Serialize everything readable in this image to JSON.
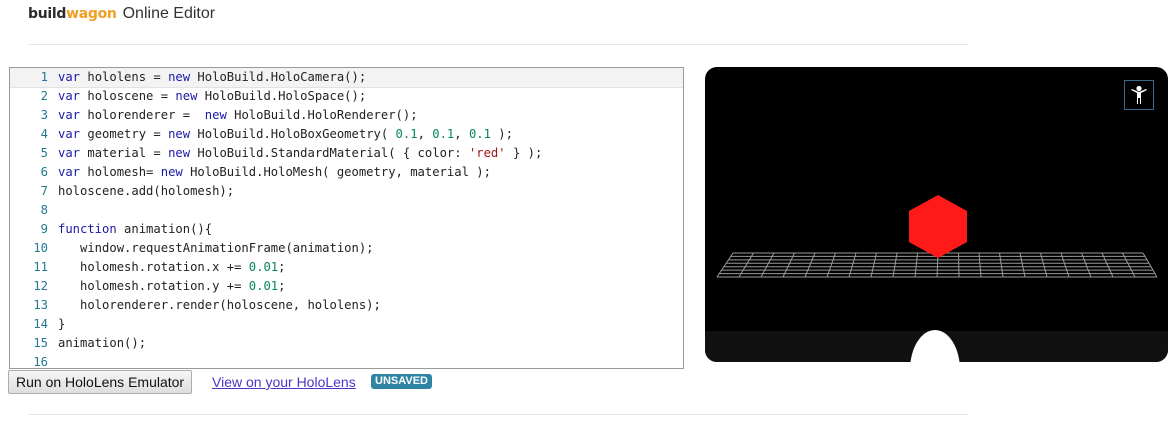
{
  "header": {
    "logo_build": "build",
    "logo_wagon": "wagon",
    "title": "Online Editor"
  },
  "editor": {
    "active_line": 1,
    "lines": [
      {
        "n": "1",
        "parts": [
          {
            "t": "kw",
            "s": "var"
          },
          {
            "t": "",
            "s": " hololens = "
          },
          {
            "t": "kw",
            "s": "new"
          },
          {
            "t": "",
            "s": " HoloBuild.HoloCamera();"
          }
        ]
      },
      {
        "n": "2",
        "parts": [
          {
            "t": "kw",
            "s": "var"
          },
          {
            "t": "",
            "s": " holoscene = "
          },
          {
            "t": "kw",
            "s": "new"
          },
          {
            "t": "",
            "s": " HoloBuild.HoloSpace();"
          }
        ]
      },
      {
        "n": "3",
        "parts": [
          {
            "t": "kw",
            "s": "var"
          },
          {
            "t": "",
            "s": " holorenderer =  "
          },
          {
            "t": "kw",
            "s": "new"
          },
          {
            "t": "",
            "s": " HoloBuild.HoloRenderer();"
          }
        ]
      },
      {
        "n": "4",
        "parts": [
          {
            "t": "kw",
            "s": "var"
          },
          {
            "t": "",
            "s": " geometry = "
          },
          {
            "t": "kw",
            "s": "new"
          },
          {
            "t": "",
            "s": " HoloBuild.HoloBoxGeometry( "
          },
          {
            "t": "num",
            "s": "0.1"
          },
          {
            "t": "",
            "s": ", "
          },
          {
            "t": "num",
            "s": "0.1"
          },
          {
            "t": "",
            "s": ", "
          },
          {
            "t": "num",
            "s": "0.1"
          },
          {
            "t": "",
            "s": " );"
          }
        ]
      },
      {
        "n": "5",
        "parts": [
          {
            "t": "kw",
            "s": "var"
          },
          {
            "t": "",
            "s": " material = "
          },
          {
            "t": "kw",
            "s": "new"
          },
          {
            "t": "",
            "s": " HoloBuild.StandardMaterial( { color: "
          },
          {
            "t": "str",
            "s": "'red'"
          },
          {
            "t": "",
            "s": " } );"
          }
        ]
      },
      {
        "n": "6",
        "parts": [
          {
            "t": "kw",
            "s": "var"
          },
          {
            "t": "",
            "s": " holomesh= "
          },
          {
            "t": "kw",
            "s": "new"
          },
          {
            "t": "",
            "s": " HoloBuild.HoloMesh( geometry, material );"
          }
        ]
      },
      {
        "n": "7",
        "parts": [
          {
            "t": "",
            "s": "holoscene.add(holomesh);"
          }
        ]
      },
      {
        "n": "8",
        "parts": [
          {
            "t": "",
            "s": ""
          }
        ]
      },
      {
        "n": "9",
        "parts": [
          {
            "t": "kw",
            "s": "function"
          },
          {
            "t": "",
            "s": " animation(){"
          }
        ]
      },
      {
        "n": "10",
        "parts": [
          {
            "t": "",
            "s": "   window.requestAnimationFrame(animation);"
          }
        ]
      },
      {
        "n": "11",
        "parts": [
          {
            "t": "",
            "s": "   holomesh.rotation.x += "
          },
          {
            "t": "num",
            "s": "0.01"
          },
          {
            "t": "",
            "s": ";"
          }
        ]
      },
      {
        "n": "12",
        "parts": [
          {
            "t": "",
            "s": "   holomesh.rotation.y += "
          },
          {
            "t": "num",
            "s": "0.01"
          },
          {
            "t": "",
            "s": ";"
          }
        ]
      },
      {
        "n": "13",
        "parts": [
          {
            "t": "",
            "s": "   holorenderer.render(holoscene, hololens);"
          }
        ]
      },
      {
        "n": "14",
        "parts": [
          {
            "t": "",
            "s": "}"
          }
        ]
      },
      {
        "n": "15",
        "parts": [
          {
            "t": "",
            "s": "animation();"
          }
        ]
      },
      {
        "n": "16",
        "parts": [
          {
            "t": "",
            "s": ""
          }
        ]
      }
    ]
  },
  "viewer": {
    "view_mode_icon": "person-icon",
    "cube_color": "#ff1a1a",
    "grid_color": "#9a9a9a"
  },
  "actions": {
    "run_label": "Run on HoloLens Emulator",
    "view_link_label": "View on your HoloLens",
    "status_badge": "UNSAVED"
  },
  "colors": {
    "keyword": "#1a1aa6",
    "number": "#098658",
    "string": "#a31515",
    "line_number": "#237893",
    "badge": "#2f84a3",
    "link": "#4a35c9"
  }
}
